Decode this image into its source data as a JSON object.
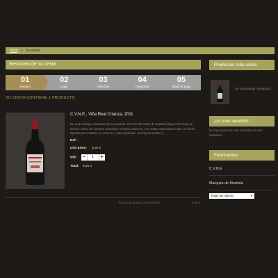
{
  "breadcrumb": {
    "home": "Inicio",
    "separator": ">",
    "current": "Su cesta"
  },
  "main": {
    "section_title": "Resumen de su cesta",
    "steps": [
      {
        "number": "01",
        "label": "Sumario",
        "active": true
      },
      {
        "number": "02",
        "label": "Login",
        "active": false
      },
      {
        "number": "03",
        "label": "Dirección",
        "active": false
      },
      {
        "number": "04",
        "label": "Transporte",
        "active": false
      },
      {
        "number": "05",
        "label": "Modo de pago",
        "active": false
      }
    ],
    "cart_count": "SU CESTA CONTIENE 1 PRODUCTO",
    "product": {
      "title": "C.V.N.E., Viña Real Crianza, 2011",
      "description": "De una bodega centenaria (la Compañía Vinícola del Norte de España) llega este Rioja de clásico estilo. De aromas complejos a frutos maduros, con notas especiadas sobre un fondo ligeramente tostado, es untuoso y aterciopelado, con buena acidez y...",
      "ref_label": "Ref.",
      "ref_value": "--",
      "unit_price_label": "Unit price:",
      "unit_price_value": "8,40 €",
      "qty_label": "Qty:",
      "qty_value": "1",
      "qty_minus": "−",
      "qty_plus": "+",
      "total_label": "Total:",
      "total_value": "8,40 €"
    },
    "footer_text": "Total de productos (IVA incluido)",
    "footer_value": "8,40 €"
  },
  "sidebar": {
    "viewed_title": "Productos más vistos",
    "viewed_desc": "De una bodega centenaria...",
    "best_title": "¡Lo más vendido!",
    "best_text": "No hay productos más vendidos en este momento",
    "brands_title": "Fabricantes",
    "brands": [
      "C.V.N.E",
      "Marqués de Murrieta"
    ],
    "brands_select": "Todas las marcas"
  },
  "colors": {
    "olive_accent": "#a6a45c",
    "active_step": "#a68e59",
    "inactive_step": "#9f9f9f",
    "price": "#c0a04c",
    "background": "#1d1a17"
  }
}
